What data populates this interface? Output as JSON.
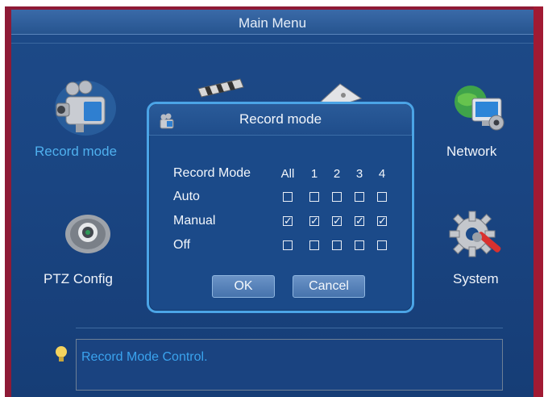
{
  "window": {
    "title": "Main Menu"
  },
  "menu": {
    "items": [
      {
        "label": "Record mode",
        "icon": "camcorder-icon",
        "active": true
      },
      {
        "label": "Network",
        "icon": "network-globe-icon"
      },
      {
        "label": "PTZ Config",
        "icon": "ptz-camera-icon"
      },
      {
        "label": "System",
        "icon": "gear-wrench-icon"
      }
    ]
  },
  "dialog": {
    "title": "Record mode",
    "header_label": "Record Mode",
    "columns": [
      "All",
      "1",
      "2",
      "3",
      "4"
    ],
    "rows": [
      {
        "label": "Auto",
        "checked": [
          false,
          false,
          false,
          false,
          false
        ]
      },
      {
        "label": "Manual",
        "checked": [
          true,
          true,
          true,
          true,
          true
        ]
      },
      {
        "label": "Off",
        "checked": [
          false,
          false,
          false,
          false,
          false
        ]
      }
    ],
    "ok_label": "OK",
    "cancel_label": "Cancel"
  },
  "help": {
    "text": "Record Mode Control.",
    "icon": "lightbulb-icon"
  },
  "colors": {
    "background": "#1b4a89",
    "accent": "#4ba4e6",
    "active_text": "#4fb0ee",
    "frame": "#8e1a36"
  }
}
